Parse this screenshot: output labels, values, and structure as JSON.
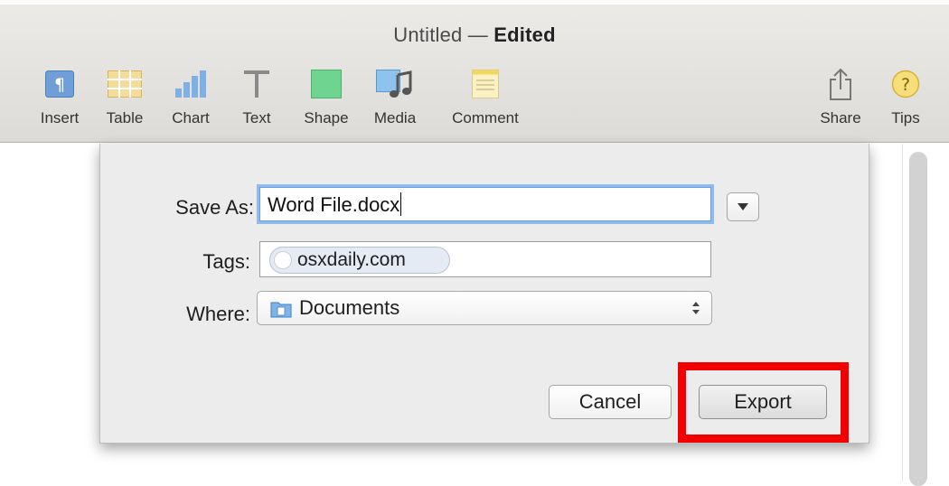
{
  "window": {
    "title": "Untitled",
    "separator": "—",
    "status": "Edited"
  },
  "toolbar": {
    "items": [
      {
        "label": "Insert",
        "icon": "paragraph-icon"
      },
      {
        "label": "Table",
        "icon": "table-icon"
      },
      {
        "label": "Chart",
        "icon": "chart-icon"
      },
      {
        "label": "Text",
        "icon": "text-icon"
      },
      {
        "label": "Shape",
        "icon": "shape-icon"
      },
      {
        "label": "Media",
        "icon": "media-icon"
      },
      {
        "label": "Comment",
        "icon": "comment-icon"
      }
    ],
    "right_items": [
      {
        "label": "Share",
        "icon": "share-icon"
      },
      {
        "label": "Tips",
        "icon": "tips-icon"
      }
    ]
  },
  "dialog": {
    "save_as_label": "Save As:",
    "save_as_value": "Word File.docx",
    "tags_label": "Tags:",
    "tag_value": "osxdaily.com",
    "where_label": "Where:",
    "where_value": "Documents",
    "cancel_label": "Cancel",
    "export_label": "Export"
  },
  "colors": {
    "accent_focus": "#8fbbef",
    "highlight_box": "#f20000",
    "toolbar_bg": "#e4e2df"
  }
}
